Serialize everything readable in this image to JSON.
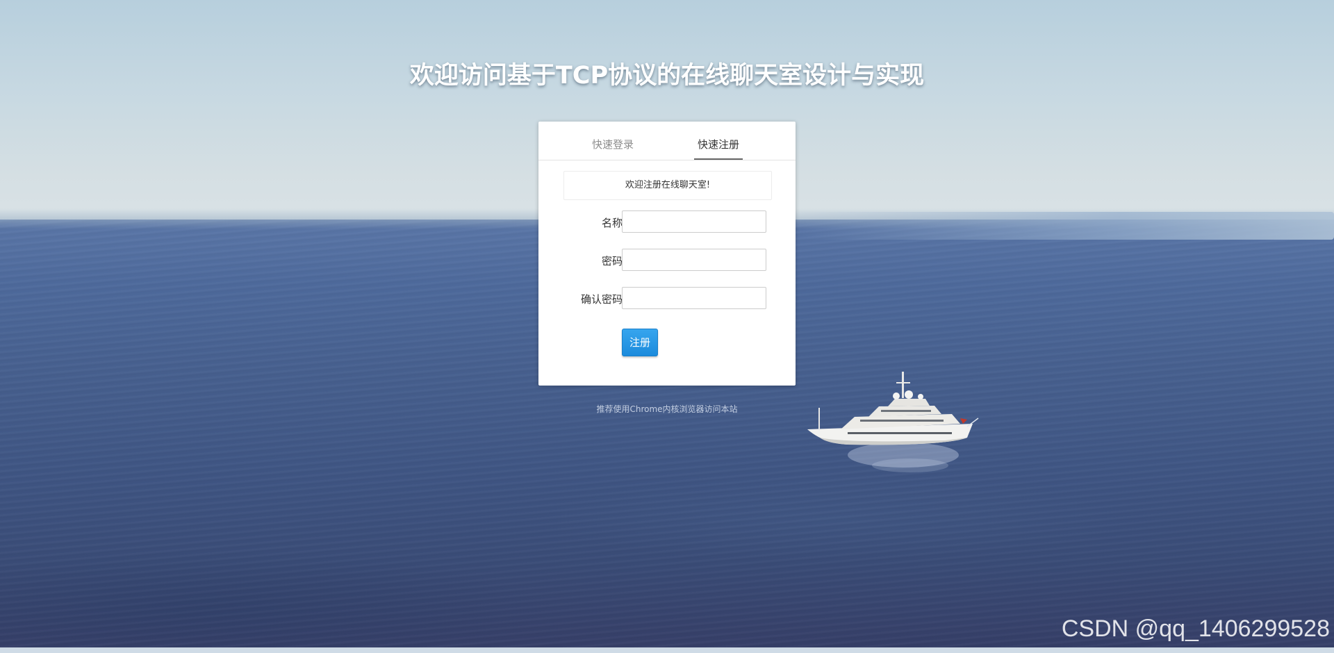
{
  "page": {
    "headline": "欢迎访问基于TCP协议的在线聊天室设计与实现",
    "hint": "推荐使用Chrome内核浏览器访问本站",
    "watermark": "CSDN @qq_1406299528"
  },
  "tabs": {
    "login": "快速登录",
    "register": "快速注册",
    "active": "register"
  },
  "register_form": {
    "notice": "欢迎注册在线聊天室!",
    "fields": [
      {
        "label": "名称:",
        "value": "",
        "placeholder": ""
      },
      {
        "label": "密码:",
        "value": "",
        "placeholder": ""
      },
      {
        "label": "确认密码:",
        "value": "",
        "placeholder": ""
      }
    ],
    "submit_label": "注册"
  },
  "colors": {
    "accent_button": "#2196e3",
    "sky": "#c8d9e2",
    "sea": "#47608f",
    "panel": "#ffffff"
  },
  "icons": [
    "yacht-image"
  ]
}
